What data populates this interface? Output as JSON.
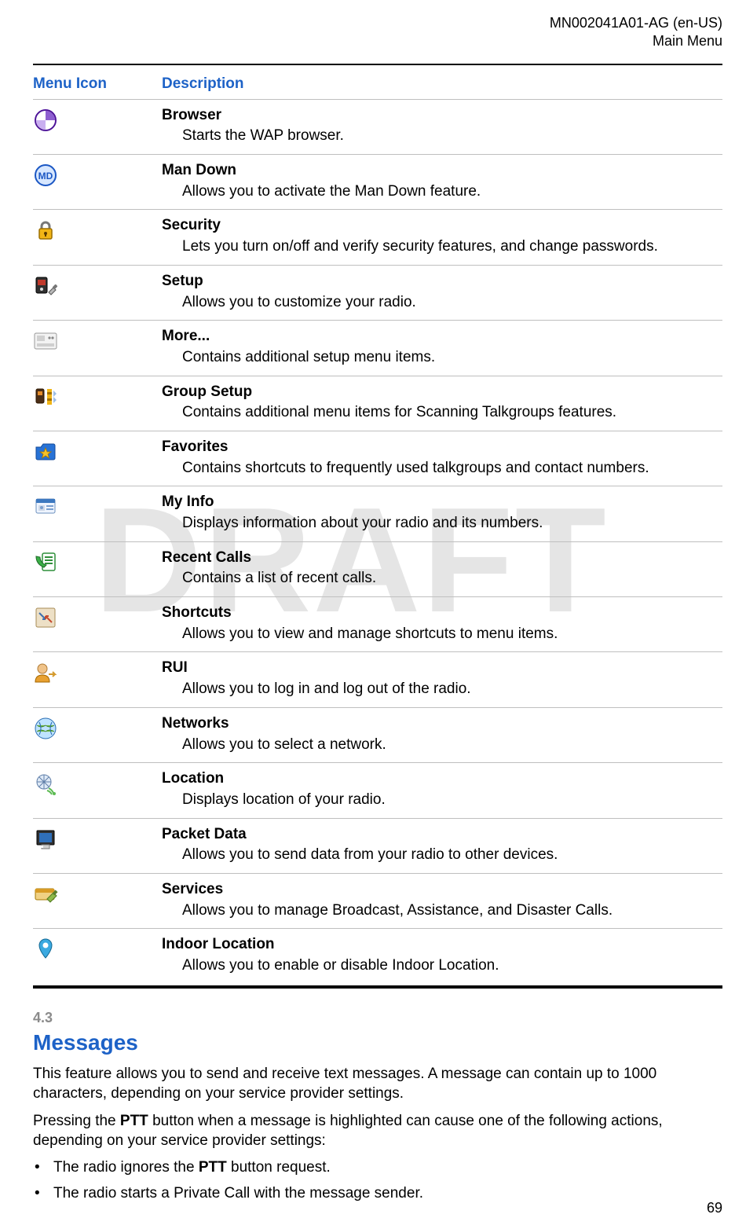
{
  "header": {
    "doc_id_line1": "MN002041A01-AG (en-US)",
    "doc_id_line2": "Main Menu"
  },
  "watermark": "DRAFT",
  "table": {
    "col_icon": "Menu Icon",
    "col_desc": "Description",
    "rows": [
      {
        "icon": "browser-icon",
        "title": "Browser",
        "desc": "Starts the WAP browser."
      },
      {
        "icon": "man-down-icon",
        "title": "Man Down",
        "desc": "Allows you to activate the Man Down feature."
      },
      {
        "icon": "security-icon",
        "title": "Security",
        "desc": "Lets you turn on/off and verify security features, and change passwords."
      },
      {
        "icon": "setup-icon",
        "title": "Setup",
        "desc": "Allows you to customize your radio."
      },
      {
        "icon": "more-icon",
        "title": "More...",
        "desc": "Contains additional setup menu items."
      },
      {
        "icon": "group-setup-icon",
        "title": "Group Setup",
        "desc": "Contains additional menu items for Scanning Talkgroups features."
      },
      {
        "icon": "favorites-icon",
        "title": "Favorites",
        "desc": "Contains shortcuts to frequently used talkgroups and contact numbers."
      },
      {
        "icon": "my-info-icon",
        "title": "My Info",
        "desc": "Displays information about your radio and its numbers."
      },
      {
        "icon": "recent-calls-icon",
        "title": "Recent Calls",
        "desc": "Contains a list of recent calls."
      },
      {
        "icon": "shortcuts-icon",
        "title": "Shortcuts",
        "desc": "Allows you to view and manage shortcuts to menu items."
      },
      {
        "icon": "rui-icon",
        "title": "RUI",
        "desc": "Allows you to log in and log out of the radio."
      },
      {
        "icon": "networks-icon",
        "title": "Networks",
        "desc": "Allows you to select a network."
      },
      {
        "icon": "location-icon",
        "title": "Location",
        "desc": "Displays location of your radio."
      },
      {
        "icon": "packet-data-icon",
        "title": "Packet Data",
        "desc": "Allows you to send data from your radio to other devices."
      },
      {
        "icon": "services-icon",
        "title": "Services",
        "desc": "Allows you to manage Broadcast, Assistance, and Disaster Calls."
      },
      {
        "icon": "indoor-location-icon",
        "title": "Indoor Location",
        "desc": "Allows you to enable or disable Indoor Location."
      }
    ]
  },
  "section": {
    "number": "4.3",
    "title": "Messages",
    "p1_a": "This feature allows you to send and receive text messages. A message can contain up to 1000 characters, depending on your service provider settings.",
    "p2_a": "Pressing the ",
    "p2_bold1": "PTT",
    "p2_b": " button when a message is highlighted can cause one of the following actions, depending on your service provider settings:",
    "bullet1_a": "The radio ignores the ",
    "bullet1_bold": "PTT",
    "bullet1_b": " button request.",
    "bullet2": "The radio starts a Private Call with the message sender."
  },
  "page_number": "69"
}
